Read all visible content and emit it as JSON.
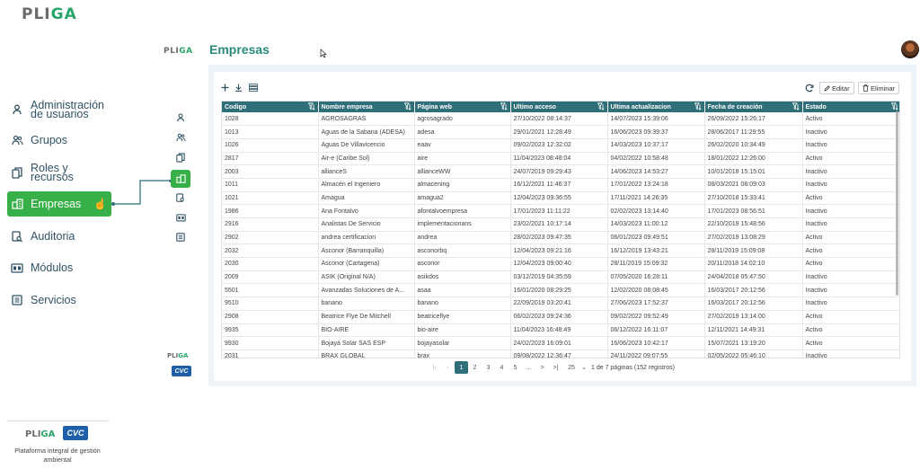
{
  "brand": {
    "logo_prefix": "PLI",
    "logo_suffix": "GA",
    "tagline": "Plataforma integral de gestión ambiental"
  },
  "menu": [
    {
      "label": "Administración de usuarios",
      "icon": "user-icon"
    },
    {
      "label": "Grupos",
      "icon": "users-icon"
    },
    {
      "label": "Roles y recursos",
      "icon": "copy-icon"
    },
    {
      "label": "Empresas",
      "icon": "building-icon",
      "active": true
    },
    {
      "label": "Auditoria",
      "icon": "audit-icon"
    },
    {
      "label": "Módulos",
      "icon": "modules-icon"
    },
    {
      "label": "Servicios",
      "icon": "services-icon"
    }
  ],
  "header": {
    "title": "Empresas"
  },
  "toolbar": {
    "edit_label": "Editar",
    "delete_label": "Eliminar"
  },
  "table": {
    "columns": [
      "Codigo",
      "Nombre empresa",
      "Página web",
      "Ultimo acceso",
      "Ultima actualizacion",
      "Fecha de creación",
      "Estado"
    ],
    "rows": [
      [
        "1028",
        "AGROSAGRAS",
        "agrosagrado",
        "27/10/2022 08:14:37",
        "14/07/2023 15:39:06",
        "26/09/2022 15:26:17",
        "Activo"
      ],
      [
        "1013",
        "Aguas de la Sabana (ADESA)",
        "adesa",
        "29/01/2021 12:28:49",
        "16/06/2023 09:39:37",
        "28/06/2017 11:29:55",
        "Inactivo"
      ],
      [
        "1026",
        "Aguas De Villavicencio",
        "eaav",
        "09/02/2023 12:32:02",
        "14/03/2023 10:37:17",
        "26/02/2020 10:34:49",
        "Inactivo"
      ],
      [
        "2817",
        "Air-e (Caribe Sol)",
        "aire",
        "11/04/2023 08:48:04",
        "04/02/2022 10:58:48",
        "18/01/2022 12:26:00",
        "Activo"
      ],
      [
        "2003",
        "allianceS",
        "allianceWW",
        "24/07/2019 09:29:43",
        "14/06/2023 14:53:27",
        "10/01/2018 15:15:01",
        "Inactivo"
      ],
      [
        "1011",
        "Almacén el Ingeniero",
        "almacening",
        "16/12/2021 11:46:37",
        "17/01/2022 13:24:18",
        "08/03/2021 08:09:03",
        "Inactivo"
      ],
      [
        "1021",
        "Amagua",
        "amagua2",
        "12/04/2023 09:36:55",
        "17/11/2021 14:26:35",
        "27/10/2018 15:33:41",
        "Activo"
      ],
      [
        "1986",
        "Ana Fontalvo",
        "afontalvoempresa",
        "17/01/2023 11:11:22",
        "02/02/2023 13:14:40",
        "17/01/2023 08:56:51",
        "Inactivo"
      ],
      [
        "2916",
        "Analistas De Servicio",
        "implementacionans",
        "23/02/2021 10:17:14",
        "14/03/2023 11:00:12",
        "22/10/2019 15:48:56",
        "Inactivo"
      ],
      [
        "2902",
        "andrea certificacion",
        "andrea",
        "28/02/2023 09:47:35",
        "06/01/2023 09:49:51",
        "27/02/2019 13:08:29",
        "Activo"
      ],
      [
        "2032",
        "Asconor (Barranquilla)",
        "asconorbq",
        "12/04/2023 09:21:16",
        "16/12/2019 13:43:21",
        "28/11/2019 15:09:08",
        "Activo"
      ],
      [
        "2030",
        "Asconor (Cartagena)",
        "asconor",
        "12/04/2023 09:00:40",
        "28/11/2019 15:09:32",
        "20/11/2018 14:02:10",
        "Activo"
      ],
      [
        "2009",
        "ASIK (Original N/A)",
        "asikdos",
        "03/12/2019 04:35:59",
        "07/05/2020 16:28:11",
        "24/04/2018 05:47:50",
        "Inactivo"
      ],
      [
        "5501",
        "Avanzadas Soluciones de A...",
        "asaa",
        "16/01/2020 08:29:25",
        "12/02/2020 08:08:45",
        "16/03/2017 20:12:56",
        "Inactivo"
      ],
      [
        "9510",
        "banano",
        "banano",
        "22/09/2019 03:20:41",
        "27/06/2023 17:52:37",
        "16/03/2017 20:12:56",
        "Inactivo"
      ],
      [
        "2908",
        "Beatrice Flye De Mitchell",
        "beatriceflye",
        "06/02/2023 09:24:36",
        "09/02/2022 09:52:49",
        "27/02/2019 13:14:00",
        "Activo"
      ],
      [
        "9935",
        "BIO-AIRE",
        "bio-aire",
        "11/04/2023 16:48:49",
        "06/12/2022 16:11:07",
        "12/11/2021 14:49:31",
        "Activo"
      ],
      [
        "9930",
        "Bojayá Solar SAS ESP",
        "bojayasolar",
        "24/02/2023 16:09:01",
        "16/06/2023 10:42:17",
        "15/07/2021 13:19:20",
        "Activo"
      ],
      [
        "2031",
        "BRAX GLOBAL",
        "brax",
        "09/08/2022 12:36:47",
        "24/11/2022 09:07:55",
        "02/05/2022 05:46:10",
        "Inactivo"
      ]
    ]
  },
  "pagination": {
    "pages": [
      "1",
      "2",
      "3",
      "4",
      "5",
      "...",
      ">",
      ">|"
    ],
    "current": "1",
    "page_size": "25",
    "info": "1 de 7 páginas (152 registros)"
  },
  "footer": {
    "cvc": "CVC"
  },
  "colors": {
    "accent": "#38b04a",
    "header_teal": "#2f6f79",
    "title": "#2a8a7a"
  }
}
